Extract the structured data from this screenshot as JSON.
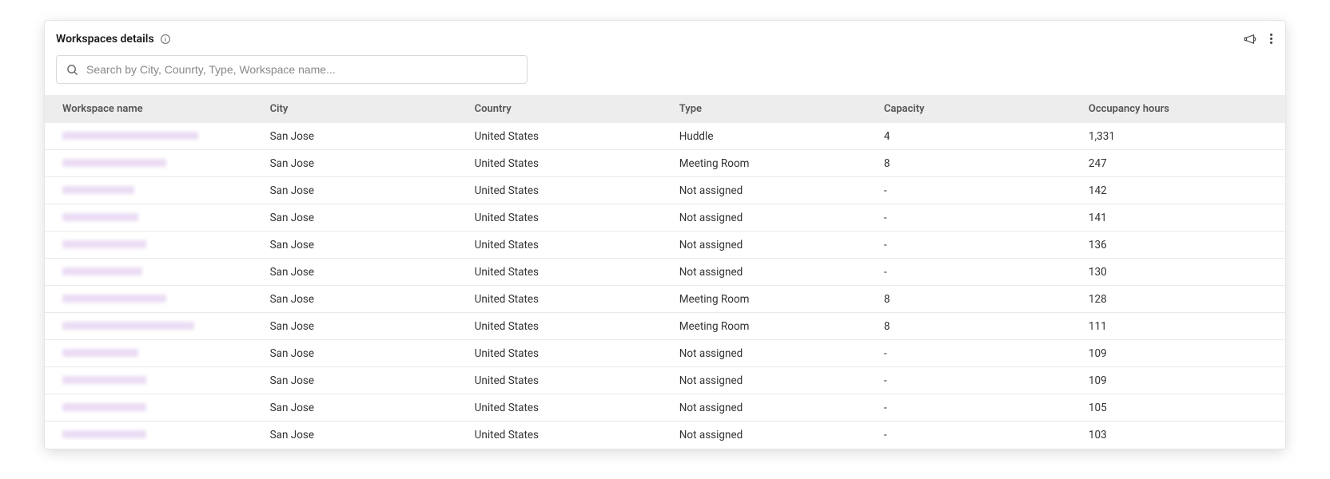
{
  "header": {
    "title": "Workspaces details"
  },
  "search": {
    "placeholder": "Search by City, Counrty, Type, Workspace name..."
  },
  "columns": {
    "workspace_name": "Workspace name",
    "city": "City",
    "country": "Country",
    "type": "Type",
    "capacity": "Capacity",
    "occupancy_hours": "Occupancy hours"
  },
  "rows": [
    {
      "name": "",
      "redact_w": 170,
      "city": "San Jose",
      "country": "United States",
      "type": "Huddle",
      "capacity": "4",
      "occupancy_hours": "1,331"
    },
    {
      "name": "",
      "redact_w": 130,
      "city": "San Jose",
      "country": "United States",
      "type": "Meeting Room",
      "capacity": "8",
      "occupancy_hours": "247"
    },
    {
      "name": "",
      "redact_w": 90,
      "city": "San Jose",
      "country": "United States",
      "type": "Not assigned",
      "capacity": "-",
      "occupancy_hours": "142"
    },
    {
      "name": "",
      "redact_w": 95,
      "city": "San Jose",
      "country": "United States",
      "type": "Not assigned",
      "capacity": "-",
      "occupancy_hours": "141"
    },
    {
      "name": "",
      "redact_w": 105,
      "city": "San Jose",
      "country": "United States",
      "type": "Not assigned",
      "capacity": "-",
      "occupancy_hours": "136"
    },
    {
      "name": "",
      "redact_w": 100,
      "city": "San Jose",
      "country": "United States",
      "type": "Not assigned",
      "capacity": "-",
      "occupancy_hours": "130"
    },
    {
      "name": "",
      "redact_w": 130,
      "city": "San Jose",
      "country": "United States",
      "type": "Meeting Room",
      "capacity": "8",
      "occupancy_hours": "128"
    },
    {
      "name": "",
      "redact_w": 165,
      "city": "San Jose",
      "country": "United States",
      "type": "Meeting Room",
      "capacity": "8",
      "occupancy_hours": "111"
    },
    {
      "name": "",
      "redact_w": 95,
      "city": "San Jose",
      "country": "United States",
      "type": "Not assigned",
      "capacity": "-",
      "occupancy_hours": "109"
    },
    {
      "name": "",
      "redact_w": 105,
      "city": "San Jose",
      "country": "United States",
      "type": "Not assigned",
      "capacity": "-",
      "occupancy_hours": "109"
    },
    {
      "name": "",
      "redact_w": 105,
      "city": "San Jose",
      "country": "United States",
      "type": "Not assigned",
      "capacity": "-",
      "occupancy_hours": "105"
    },
    {
      "name": "",
      "redact_w": 105,
      "city": "San Jose",
      "country": "United States",
      "type": "Not assigned",
      "capacity": "-",
      "occupancy_hours": "103"
    }
  ]
}
